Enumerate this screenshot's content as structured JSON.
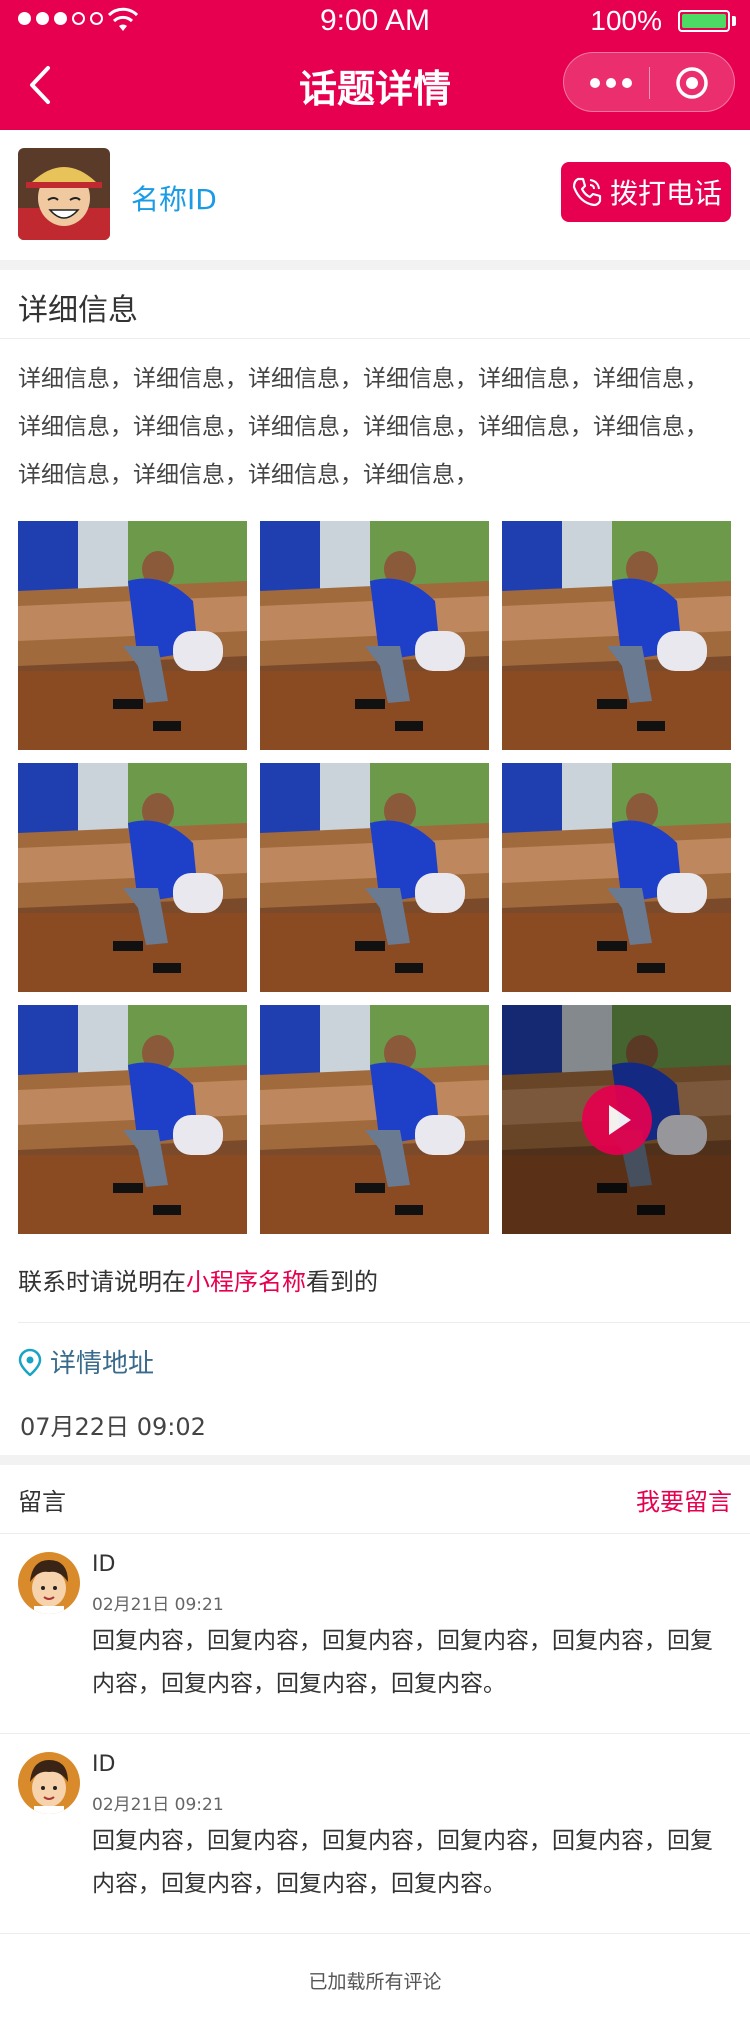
{
  "status_bar": {
    "time": "9:00 AM",
    "battery": "100%"
  },
  "nav": {
    "title": "话题详情"
  },
  "profile": {
    "name": "名称ID",
    "call_label": "拨打电话"
  },
  "detail": {
    "title": "详细信息",
    "lines": [
      "详细信息，详细信息，详细信息，详细信息，详细信息，详细信息，",
      "详细信息，详细信息，详细信息，详细信息，详细信息，详细信息，",
      "详细信息，详细信息，详细信息，详细信息，"
    ]
  },
  "note": {
    "prefix": "联系时请说明在",
    "highlight": "小程序名称",
    "suffix": "看到的"
  },
  "address": {
    "label": "详情地址"
  },
  "datetime": "07月22日 09:02",
  "comments": {
    "label": "留言",
    "add_label": "我要留言",
    "items": [
      {
        "name": "ID",
        "time": "02月21日 09:21",
        "text": "回复内容，回复内容，回复内容，回复内容，回复内容，回复内容，回复内容，回复内容，回复内容。"
      },
      {
        "name": "ID",
        "time": "02月21日 09:21",
        "text": "回复内容，回复内容，回复内容，回复内容，回复内容，回复内容，回复内容，回复内容，回复内容。"
      }
    ]
  },
  "footer": "已加载所有评论",
  "colors": {
    "brand": "#e6004f",
    "link_blue": "#1a9be6"
  }
}
